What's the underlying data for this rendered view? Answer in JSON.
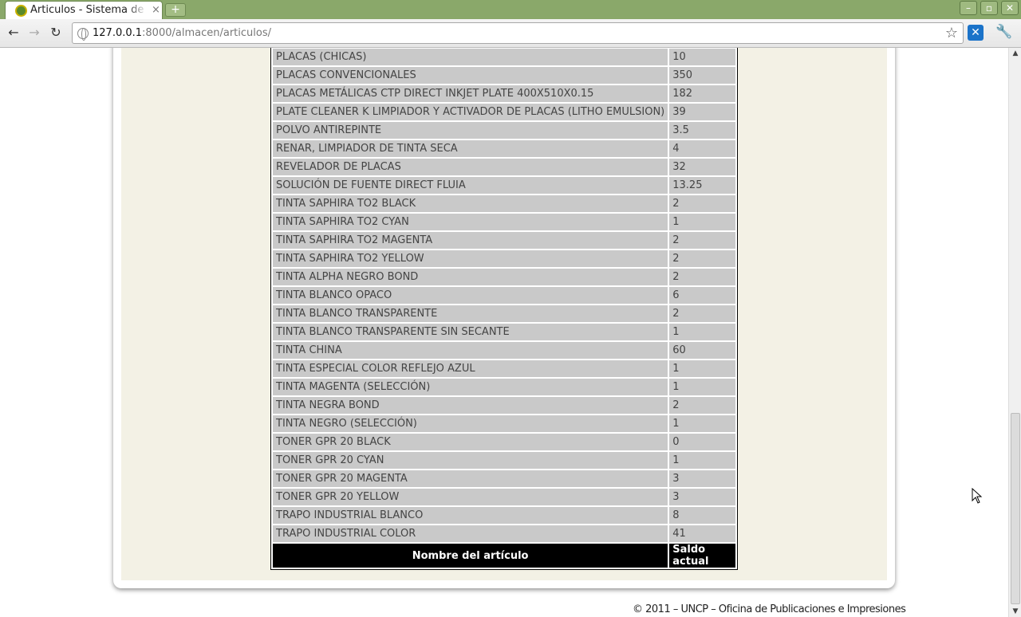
{
  "browser": {
    "tab_title": "Articulos - Sistema de re",
    "tab_close": "×",
    "new_tab": "+",
    "window_minimize": "–",
    "window_restore": "▫",
    "window_close": "✕",
    "back": "←",
    "forward": "→",
    "reload": "↻",
    "url_host": "127.0.0.1",
    "url_path": ":8000/almacen/articulos/",
    "bookmark_star": "☆",
    "extension_label": "✕",
    "menu_wrench": "🔧"
  },
  "table": {
    "rows": [
      {
        "name": "PLACAS (CHICAS)",
        "qty": "10"
      },
      {
        "name": "PLACAS CONVENCIONALES",
        "qty": "350"
      },
      {
        "name": "PLACAS METÁLICAS CTP DIRECT INKJET PLATE 400X510X0.15",
        "qty": "182"
      },
      {
        "name": "PLATE CLEANER K LIMPIADOR Y ACTIVADOR DE PLACAS (LITHO EMULSION)",
        "qty": "39"
      },
      {
        "name": "POLVO ANTIREPINTE",
        "qty": "3.5"
      },
      {
        "name": "RENAR, LIMPIADOR DE TINTA SECA",
        "qty": "4"
      },
      {
        "name": "REVELADOR DE PLACAS",
        "qty": "32"
      },
      {
        "name": "SOLUCIÓN DE FUENTE DIRECT FLUIA",
        "qty": "13.25"
      },
      {
        "name": "TINTA SAPHIRA TO2 BLACK",
        "qty": "2"
      },
      {
        "name": "TINTA SAPHIRA TO2 CYAN",
        "qty": "1"
      },
      {
        "name": "TINTA SAPHIRA TO2 MAGENTA",
        "qty": "2"
      },
      {
        "name": "TINTA SAPHIRA TO2 YELLOW",
        "qty": "2"
      },
      {
        "name": "TINTA ALPHA NEGRO BOND",
        "qty": "2"
      },
      {
        "name": "TINTA BLANCO OPACO",
        "qty": "6"
      },
      {
        "name": "TINTA BLANCO TRANSPARENTE",
        "qty": "2"
      },
      {
        "name": "TINTA BLANCO TRANSPARENTE SIN SECANTE",
        "qty": "1"
      },
      {
        "name": "TINTA CHINA",
        "qty": "60"
      },
      {
        "name": "TINTA ESPECIAL COLOR REFLEJO AZUL",
        "qty": "1"
      },
      {
        "name": "TINTA MAGENTA (SELECCIÓN)",
        "qty": "1"
      },
      {
        "name": "TINTA NEGRA BOND",
        "qty": "2"
      },
      {
        "name": "TINTA NEGRO (SELECCIÓN)",
        "qty": "1"
      },
      {
        "name": "TONER GPR 20 BLACK",
        "qty": "0"
      },
      {
        "name": "TONER GPR 20 CYAN",
        "qty": "1"
      },
      {
        "name": "TONER GPR 20 MAGENTA",
        "qty": "3"
      },
      {
        "name": "TONER GPR 20 YELLOW",
        "qty": "3"
      },
      {
        "name": "TRAPO INDUSTRIAL BLANCO",
        "qty": "8"
      },
      {
        "name": "TRAPO INDUSTRIAL COLOR",
        "qty": "41"
      }
    ],
    "footer_headers": {
      "name": "Nombre del artículo",
      "qty": "Saldo actual"
    }
  },
  "footer": {
    "copyright": "© 2011 – UNCP – Oficina de Publicaciones e Impresiones"
  },
  "scrollbar": {
    "up_arrow": "▲",
    "down_arrow": "▼"
  },
  "colors": {
    "titlebar": "#8aa86a",
    "page_background": "#f3f1e5",
    "cell_background": "#c9c9c9",
    "header_background": "#000000"
  }
}
